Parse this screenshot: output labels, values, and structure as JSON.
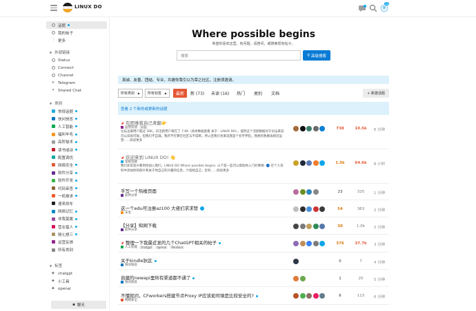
{
  "header": {
    "logo_text": "LINUX DO",
    "notification_count": "12"
  },
  "sidebar": {
    "top_items": [
      {
        "label": "话题",
        "icon": "layers-icon"
      },
      {
        "label": "我的帖子",
        "icon": "user-icon"
      },
      {
        "label": "更多",
        "icon": "more-icon"
      }
    ],
    "external_head": "外部链接",
    "external_items": [
      {
        "label": "Status"
      },
      {
        "label": "Connect"
      },
      {
        "label": "Channel"
      },
      {
        "label": "Telegram"
      },
      {
        "label": "Shared Chat"
      }
    ],
    "categories_head": "类别",
    "categories": [
      {
        "label": "常规话题",
        "color": "#25AAE2"
      },
      {
        "label": "快问快答",
        "color": "#0E76BD"
      },
      {
        "label": "人工智能",
        "color": "#00A94F"
      },
      {
        "label": "福利羊毛",
        "color": "#F7941D"
      },
      {
        "label": "高阶秘术",
        "color": "#9E9E9E"
      },
      {
        "label": "读书成诗",
        "color": "#BF1E2E"
      },
      {
        "label": "配置调优",
        "color": "#12A89D"
      },
      {
        "label": "网络安全",
        "color": "#E45735"
      },
      {
        "label": "软件分享",
        "color": "#652D90"
      },
      {
        "label": "软件开发",
        "color": "#3AB54A"
      },
      {
        "label": "代码审查",
        "color": "#8C6238"
      },
      {
        "label": "一机难求",
        "color": "#F1592A"
      },
      {
        "label": "速来拼车",
        "color": "#231F20"
      },
      {
        "label": "网络记忆",
        "color": "#0088CC"
      },
      {
        "label": "非我莫属",
        "color": "#9C4A9C"
      },
      {
        "label": "营业猛人",
        "color": "#D4145A"
      },
      {
        "label": "随七想三",
        "color": "#AB9364"
      },
      {
        "label": "运营反馈",
        "color": "#92278F"
      },
      {
        "label": "所有类别",
        "color": "#888888"
      }
    ],
    "tags_head": "标签",
    "tags": [
      {
        "label": "chatgpt"
      },
      {
        "label": "小工具"
      },
      {
        "label": "openai"
      }
    ],
    "chat_label": "聊天"
  },
  "hero": {
    "title": "Where possible begins",
    "subtitle": "希望你喜欢这里。有问题，请搜问，或搜索现有帖子。",
    "search_placeholder": "搜索",
    "advanced_label": "高级搜索"
  },
  "banner": "真诚、友善、团结、专业，共建你我引以为荣之社区。注册须邀请。",
  "nav": {
    "all_categories": "所有类别",
    "all_tags": "所有标签",
    "tabs": [
      {
        "label": "最新"
      },
      {
        "label": "新 (73)"
      },
      {
        "label": "未读 (16)"
      },
      {
        "label": "热门"
      },
      {
        "label": "类别"
      },
      {
        "label": "文档"
      }
    ],
    "new_topic": "+ 新建话题"
  },
  "new_topics_bar": "查看 2 个新的或更新的话题",
  "topics": [
    {
      "title": "有困难我自己来翻👉",
      "category": "运营反馈",
      "cat_color": "#92278F",
      "tags": [
        "公告"
      ],
      "excerpt": "论坛注册用户超过 30K。日活跃用户来在了 7.6K（具体数据查看 关于 - LINUX DO）。诚然这个活跃数据对于论坛来说可以说很可观，但我们不自满。我开不打算在社区与不成断，所以且我们也来说我是个有字弃犯。我想的我要再接近运营......阅读更多",
      "replies": "738",
      "views": "10.5k",
      "activity": "6 分钟",
      "avatars": [
        "#a36a3a",
        "#111111",
        "#3a7d6b",
        "#6b6b6b",
        "#0b7fd4"
      ],
      "replies_class": "hot",
      "views_class": "hot"
    },
    {
      "title": "欢迎来到 LINUX DO! 👋",
      "category": "常规话题",
      "cat_color": "#25AAE2",
      "tags": [],
      "excerpt": "我们非常高兴看到你加入我们。LINUX DO Where possible begins. 以下是一些可以帮助你入门的事情: 🔵 在个人资料中添加你的照片和关于你自己的兴趣的信息，介绍给自己，您有......阅读更多",
      "replies": "1.5k",
      "views": "64.6k",
      "activity": "8 小时",
      "avatars": [
        "#c9a227",
        "#1f2937",
        "#5b7bb5",
        "#f07c2c",
        "#0ea5e9"
      ],
      "replies_class": "warm",
      "views_class": "hot"
    },
    {
      "title": "手写一个热楼页面",
      "category": "软件分享",
      "cat_color": "#652D90",
      "tags": [],
      "excerpt": "",
      "replies": "23",
      "views": "325",
      "activity": "1 分钟",
      "avatars": [
        "#b76e9e",
        "#6b8e23",
        "#2e86c1",
        "#888888"
      ],
      "replies_class": "",
      "views_class": ""
    },
    {
      "title": "这一个edu可注册az100 大佬们求求赞",
      "category": "羊毛",
      "cat_color": "#F7941D",
      "tags": [],
      "excerpt": "",
      "replies": "54",
      "views": "363",
      "activity": "2 分钟",
      "avatars": [
        "#bfbfbf",
        "#2d2d2d",
        "#4a90d9",
        "#cc3333",
        "#3a3a3a"
      ],
      "replies_class": "warm",
      "views_class": ""
    },
    {
      "title": "【分享】知网下载",
      "category": "软件分享",
      "cat_color": "#652D90",
      "tags": [],
      "excerpt": "",
      "replies": "30",
      "views": "1.0k",
      "activity": "2 分钟",
      "avatars": [
        "#444444",
        "#7a7a7a",
        "#c0a060",
        "#2e8b57",
        "#5577aa"
      ],
      "replies_class": "warm",
      "views_class": ""
    },
    {
      "title": "整理一下我最近发的几个ChatGPT相关的帖子",
      "category": "人工智能",
      "cat_color": "#00A94F",
      "tags": [
        "chatgpt",
        "openai",
        "Pandora"
      ],
      "excerpt": "",
      "replies": "376",
      "views": "37.7k",
      "activity": "3 分钟",
      "avatars": [
        "#8e6bb5",
        "#c28d5a",
        "#3b82f6",
        "#7b7b7b",
        "#0ea5e9"
      ],
      "replies_class": "warm",
      "views_class": "hot"
    },
    {
      "title": "关于kindle狄区",
      "category": "快问快答",
      "cat_color": "#0E76BD",
      "tags": [],
      "excerpt": "",
      "replies": "0",
      "views": "7",
      "activity": "4 分钟",
      "avatars": [
        "#2d3748"
      ],
      "replies_class": "",
      "views_class": ""
    },
    {
      "title": "自建的newapi里所有渠道都不通了",
      "category": "快问快答",
      "cat_color": "#0E76BD",
      "tags": [],
      "excerpt": "",
      "replies": "1",
      "views": "20",
      "activity": "5 分钟",
      "avatars": [
        "#e07b39",
        "#6aa84f"
      ],
      "replies_class": "",
      "views_class": ""
    },
    {
      "title": "不懂就问，CFworkers搭建节点Proxy IP应该如何填是比较安全的?",
      "category": "网络安全",
      "cat_color": "#E45735",
      "tags": [],
      "excerpt": "",
      "replies": "6",
      "views": "113",
      "activity": "6 分钟",
      "avatars": [
        "#b4532a",
        "#4caf50",
        "#8d6e63",
        "#e91e63",
        "#607d8b"
      ],
      "replies_class": "",
      "views_class": ""
    }
  ]
}
